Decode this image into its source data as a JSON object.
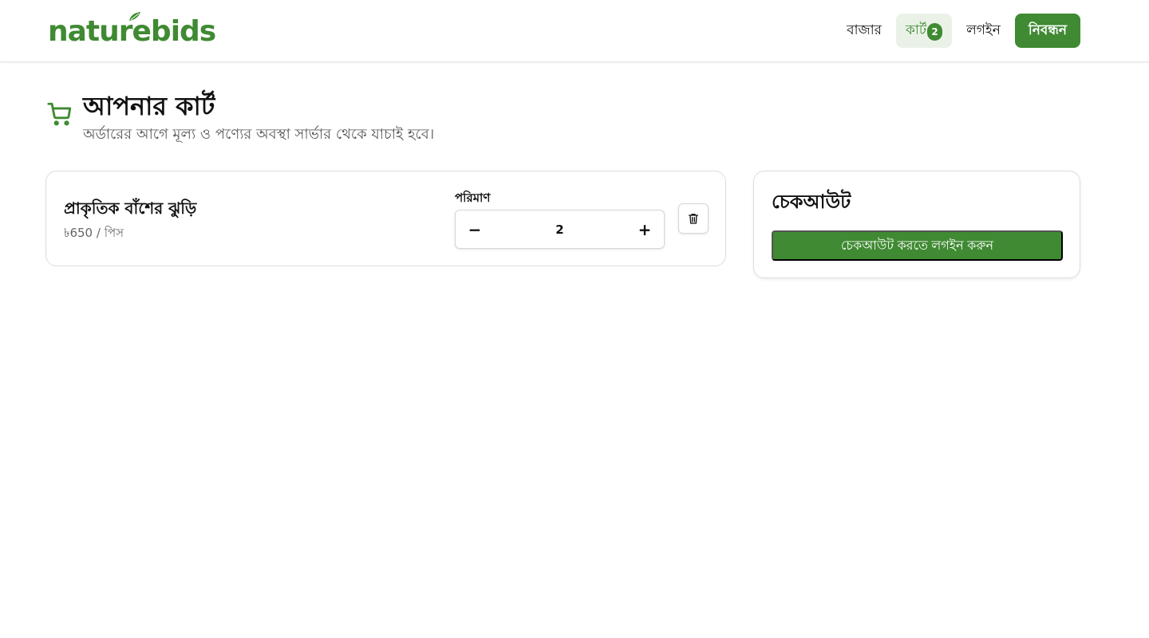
{
  "brand": {
    "name": "naturebids",
    "color": "#3f8a32"
  },
  "nav": {
    "market": "বাজার",
    "cart": "কার্ট",
    "cart_count": "2",
    "login": "লগইন",
    "register": "নিবন্ধন"
  },
  "page": {
    "title": "আপনার কার্ট",
    "subtitle": "অর্ডারের আগে মূল্য ও পণ্যের অবস্থা সার্ভার থেকে যাচাই হবে।",
    "icon": "cart-icon"
  },
  "cart_items": [
    {
      "name": "প্রাকৃতিক বাঁশের ঝুড়ি",
      "price": "৳650 / পিস",
      "quantity_label": "পরিমাণ",
      "quantity": "2",
      "decrease": "−",
      "increase": "+"
    }
  ],
  "checkout": {
    "title": "চেকআউট",
    "button": "চেকআউট করতে লগইন করুন"
  }
}
